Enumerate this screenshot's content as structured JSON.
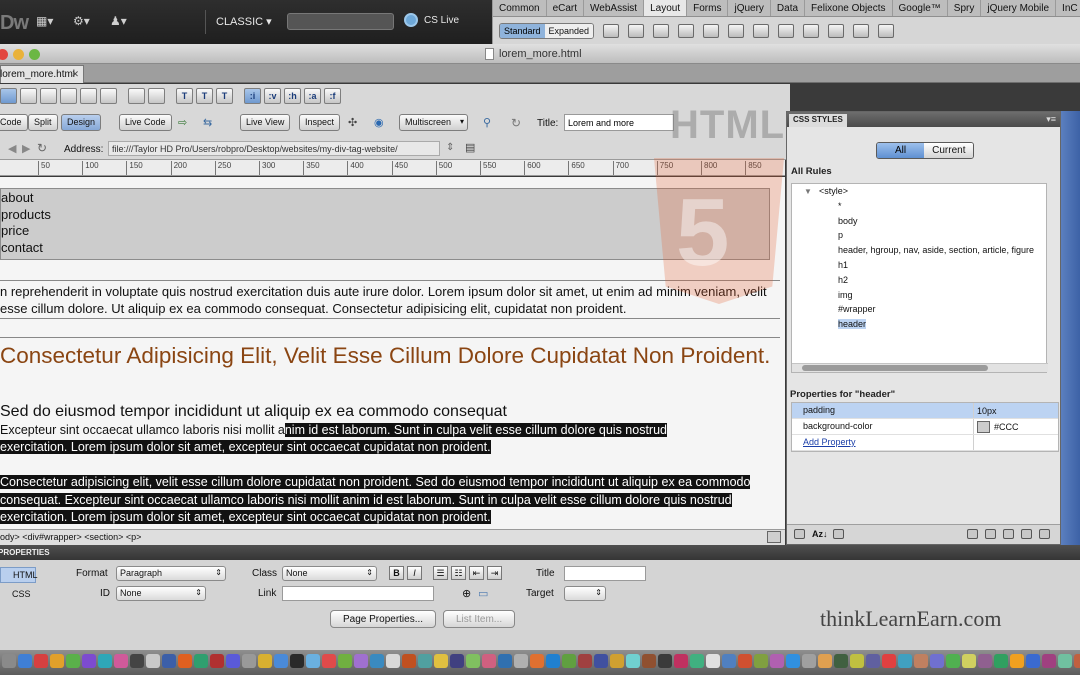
{
  "app": {
    "logo": "Dw",
    "workspace": "CLASSIC ▾",
    "search_placeholder": "",
    "cs_live": "CS Live"
  },
  "insert_panel": {
    "tabs": [
      "Common",
      "eCart",
      "WebAssist",
      "Layout",
      "Forms",
      "jQuery",
      "Data",
      "Felixone Objects",
      "Google™",
      "Spry",
      "jQuery Mobile",
      "InC"
    ],
    "active_tab": "Layout",
    "mode_standard": "Standard",
    "mode_expanded": "Expanded"
  },
  "document": {
    "window_title": "lorem_more.html",
    "tab_label": "lorem_more.html",
    "toolbar_icons": [
      "T",
      "T",
      "T",
      ":i",
      ":v",
      ":h",
      ":a",
      ":f"
    ],
    "view_buttons": {
      "code": "Code",
      "split": "Split",
      "design": "Design",
      "live_code": "Live Code",
      "live_view": "Live View",
      "inspect": "Inspect",
      "multiscreen": "Multiscreen"
    },
    "title_label": "Title:",
    "title_value": "Lorem and more",
    "address_label": "Address:",
    "address_value": "file:///Taylor HD Pro/Users/robpro/Desktop/websites/my-div-tag-website/",
    "ruler_marks": [
      "50",
      "100",
      "150",
      "200",
      "250",
      "300",
      "350",
      "400",
      "450",
      "500",
      "550",
      "600",
      "650",
      "700",
      "750",
      "800",
      "850"
    ]
  },
  "design_view": {
    "nav_items": [
      "about",
      "products",
      "price",
      "contact"
    ],
    "para1": "n reprehenderit in voluptate quis nostrud exercitation duis aute irure dolor. Lorem ipsum dolor sit amet, ut enim ad minim veniam, velit esse cillum dolore. Ut aliquip ex ea commodo consequat. Consectetur adipisicing elit, cupidatat non proident.",
    "heading1": "Consectetur Adipisicing Elit, Velit Esse Cillum Dolore Cupidatat Non Proident.",
    "heading2": "Sed do eiusmod tempor incididunt ut aliquip ex ea commodo consequat",
    "para2_plain": "Excepteur sint occaecat ullamco laboris nisi mollit a",
    "para2_selected": "nim id est laborum. Sunt in culpa velit esse cillum dolore quis nostrud",
    "para2_line2": "exercitation. Lorem ipsum dolor sit amet, excepteur sint occaecat cupidatat non proident.",
    "para3": "Consectetur adipisicing elit, velit esse cillum dolore cupidatat non proident. Sed do eiusmod tempor incididunt ut aliquip ex ea commodo consequat. Excepteur sint occaecat ullamco laboris nisi mollit anim id est laborum. Sunt in culpa velit esse cillum dolore quis nostrud exercitation. Lorem ipsum dolor sit amet, excepteur sint occaecat cupidatat non proident.",
    "tag_selector": "ody>  <div#wrapper>  <section>  <p>"
  },
  "watermark": {
    "html_text": "HTML",
    "five": "5"
  },
  "css_panel": {
    "tab_label": "CSS STYLES",
    "all_button": "All",
    "current_button": "Current",
    "all_rules_label": "All Rules",
    "rules": [
      "<style>",
      "*",
      "body",
      "p",
      "header, hgroup, nav, aside, section, article, figure",
      "h1",
      "h2",
      "img",
      "#wrapper",
      "header"
    ],
    "selected_rule": "header",
    "props_title": "Properties for \"header\"",
    "properties": [
      {
        "name": "padding",
        "value": "10px"
      },
      {
        "name": "background-color",
        "value": "#CCC"
      }
    ],
    "add_property": "Add Property",
    "swatch_color": "#CCCCCC"
  },
  "properties_inspector": {
    "header": "PROPERTIES",
    "html_tab": "HTML",
    "css_tab": "CSS",
    "format_label": "Format",
    "format_value": "Paragraph",
    "class_label": "Class",
    "class_value": "None",
    "id_label": "ID",
    "id_value": "None",
    "link_label": "Link",
    "link_value": "",
    "title_label": "Title",
    "target_label": "Target",
    "bold": "B",
    "italic": "I",
    "page_properties": "Page Properties...",
    "list_item": "List Item...",
    "brand": "thinkLearnEarn.com"
  },
  "colors": {
    "heading_color": "#8a4512",
    "header_bg": "#CCCCCC",
    "selection": "#111111",
    "accent_blue": "#8fb3db"
  }
}
